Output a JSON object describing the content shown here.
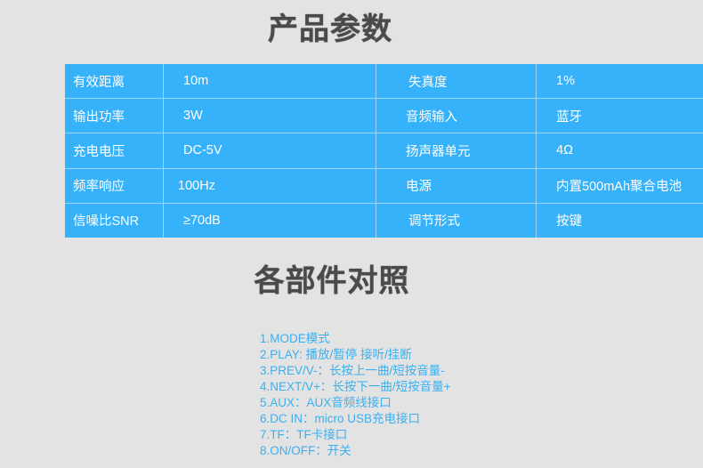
{
  "headings": {
    "specs": "产品参数",
    "parts": "各部件对照"
  },
  "specs": {
    "rows": [
      {
        "label1": "有效距离",
        "value1": "10m",
        "label2": "失真度",
        "value2": "1%"
      },
      {
        "label1": "输出功率",
        "value1": "3W",
        "label2": "音频输入",
        "value2": "蓝牙"
      },
      {
        "label1": "充电电压",
        "value1": "DC-5V",
        "label2": "扬声器单元",
        "value2": "4Ω"
      },
      {
        "label1": "频率响应",
        "value1": "100Hz",
        "label2": "电源",
        "value2": "内置500mAh聚合电池"
      },
      {
        "label1": "信噪比SNR",
        "value1": "≥70dB",
        "label2": "调节形式",
        "value2": "按键"
      }
    ]
  },
  "parts": {
    "items": [
      "1.MODE模式",
      "2.PLAY: 播放/暂停 接听/挂断",
      "3.PREV/V-：长按上一曲/短按音量-",
      "4.NEXT/V+：长按下一曲/短按音量+",
      "5.AUX：AUX音频线接口",
      "6.DC IN：micro USB充电接口",
      "7.TF：TF卡接口",
      "8.ON/OFF：开关"
    ]
  },
  "colors": {
    "table_bg": "#36b2fb",
    "table_border": "#9ed6fb",
    "heading": "#4a4a4a",
    "list_text": "#3ab0f0",
    "page_bg": "#e3e3e3"
  }
}
